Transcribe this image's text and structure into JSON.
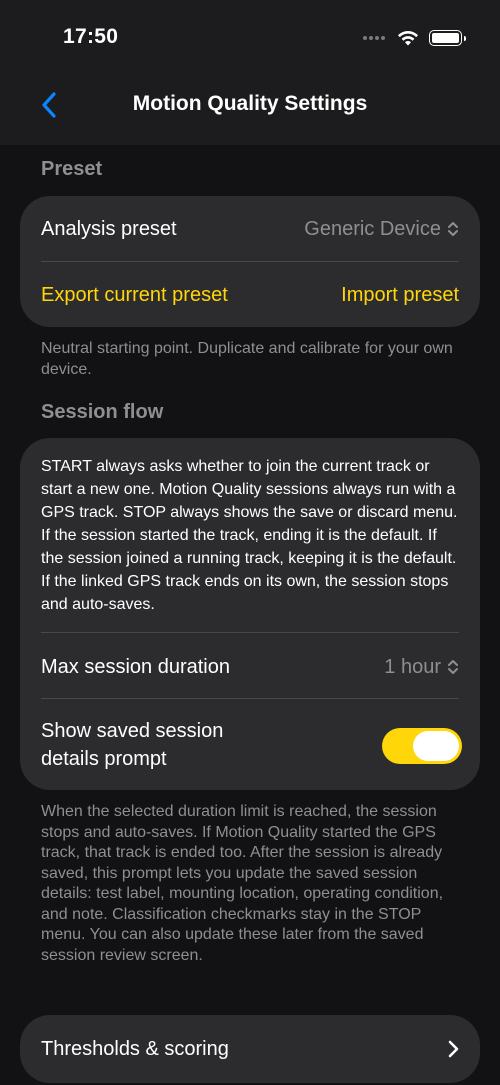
{
  "status": {
    "time": "17:50"
  },
  "nav": {
    "title": "Motion Quality Settings",
    "back_icon": "chevron-left-icon"
  },
  "preset": {
    "header": "Preset",
    "analysis_label": "Analysis preset",
    "analysis_value": "Generic Device",
    "export_label": "Export current preset",
    "import_label": "Import preset",
    "footer": "Neutral starting point. Duplicate and calibrate for your own device."
  },
  "session_flow": {
    "header": "Session flow",
    "description": "START always asks whether to join the current track or start a new one. Motion Quality sessions always run with a GPS track. STOP always shows the save or discard menu. If the session started the track, ending it is the default. If the session joined a running track, keeping it is the default. If the linked GPS track ends on its own, the session stops and auto-saves.",
    "max_duration_label": "Max session duration",
    "max_duration_value": "1 hour",
    "prompt_label": "Show saved session details prompt",
    "prompt_enabled": true,
    "footer": "When the selected duration limit is reached, the session stops and auto-saves. If Motion Quality started the GPS track, that track is ended too. After the session is already saved, this prompt lets you update the saved session details: test label, mounting location, operating condition, and note. Classification checkmarks stay in the STOP menu. You can also update these later from the saved session review screen."
  },
  "thresholds": {
    "label": "Thresholds & scoring"
  },
  "colors": {
    "accent": "#ffd60a",
    "back_blue": "#0a84ff",
    "card": "#2c2c2e",
    "secondary_text": "#8e8e93"
  }
}
